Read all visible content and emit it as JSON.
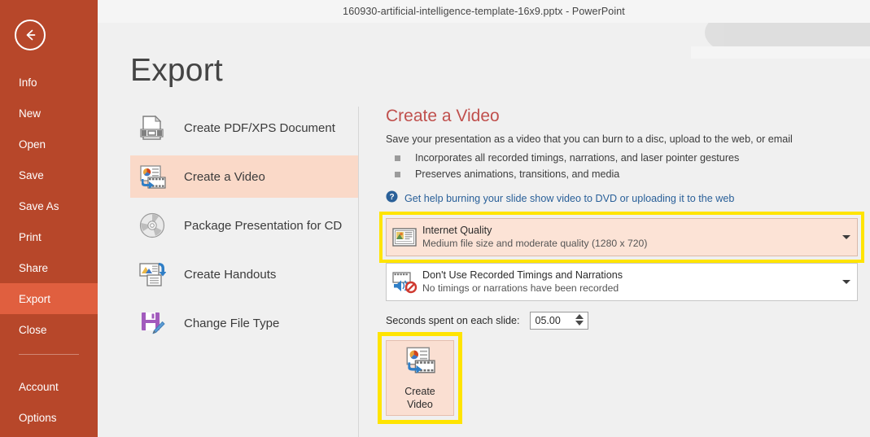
{
  "window": {
    "title": "160930-artificial-intelligence-template-16x9.pptx - PowerPoint"
  },
  "back_button": {
    "icon": "back-arrow-icon"
  },
  "sidebar": {
    "items": [
      {
        "label": "Info",
        "active": false
      },
      {
        "label": "New",
        "active": false
      },
      {
        "label": "Open",
        "active": false
      },
      {
        "label": "Save",
        "active": false
      },
      {
        "label": "Save As",
        "active": false
      },
      {
        "label": "Print",
        "active": false
      },
      {
        "label": "Share",
        "active": false
      },
      {
        "label": "Export",
        "active": true
      },
      {
        "label": "Close",
        "active": false
      }
    ],
    "footer_items": [
      {
        "label": "Account"
      },
      {
        "label": "Options"
      }
    ]
  },
  "page": {
    "title": "Export"
  },
  "export_options": [
    {
      "label": "Create PDF/XPS Document",
      "icon": "document-icon",
      "selected": false
    },
    {
      "label": "Create a Video",
      "icon": "video-icon",
      "selected": true
    },
    {
      "label": "Package Presentation for CD",
      "icon": "cd-disc-icon",
      "selected": false
    },
    {
      "label": "Create Handouts",
      "icon": "handouts-icon",
      "selected": false
    },
    {
      "label": "Change File Type",
      "icon": "floppy-pencil-icon",
      "selected": false
    }
  ],
  "detail": {
    "title": "Create a Video",
    "description": "Save your presentation as a video that you can burn to a disc, upload to the web, or email",
    "bullets": [
      "Incorporates all recorded timings, narrations, and laser pointer gestures",
      "Preserves animations, transitions, and media"
    ],
    "help_link": "Get help burning your slide show video to DVD or uploading it to the web",
    "help_icon": "help-question-icon",
    "quality_combo": {
      "icon": "slide-quality-icon",
      "main": "Internet Quality",
      "sub": "Medium file size and moderate quality (1280 x 720)",
      "highlighted": true
    },
    "narration_combo": {
      "icon": "no-narration-icon",
      "main": "Don't Use Recorded Timings and Narrations",
      "sub": "No timings or narrations have been recorded",
      "highlighted": false
    },
    "seconds": {
      "label": "Seconds spent on each slide:",
      "value": "05.00"
    },
    "create_video_button": {
      "line1": "Create",
      "line2": "Video",
      "icon": "video-icon",
      "highlighted": true
    }
  },
  "colors": {
    "accent_orange": "#b7472a",
    "active_nav": "#e05f3f",
    "selection_peach": "#fad9c8",
    "highlight_yellow": "#ffe400",
    "link_blue": "#2a6099",
    "title_red": "#c0504d"
  }
}
